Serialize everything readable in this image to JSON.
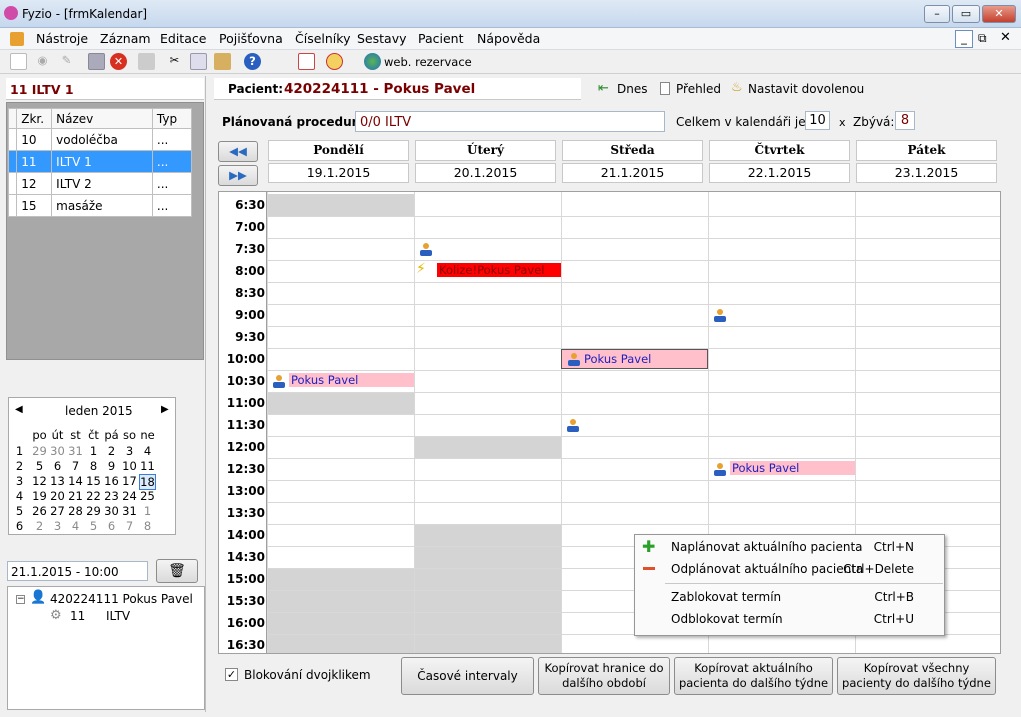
{
  "window": {
    "title": "Fyzio - [frmKalendar]"
  },
  "menu": [
    "Nástroje",
    "Záznam",
    "Editace",
    "Pojišťovna",
    "Číselníky",
    "Sestavy",
    "Pacient",
    "Nápověda"
  ],
  "toolbar": {
    "web_label": "web. rezervace"
  },
  "left": {
    "header": "11 ILTV 1",
    "table": {
      "cols": [
        "Zkr.",
        "Název",
        "Typ"
      ],
      "rows": [
        [
          "10",
          "vodoléčba",
          "..."
        ],
        [
          "11",
          "ILTV 1",
          "..."
        ],
        [
          "12",
          "ILTV 2",
          "..."
        ],
        [
          "15",
          "masáže",
          "..."
        ]
      ],
      "selected_index": 1
    },
    "calendar": {
      "month": "leden 2015",
      "weekdays": [
        "po",
        "út",
        "st",
        "čt",
        "pá",
        "so",
        "ne"
      ],
      "weeks": [
        [
          "1",
          "29",
          "30",
          "31",
          "1",
          "2",
          "3",
          "4"
        ],
        [
          "2",
          "5",
          "6",
          "7",
          "8",
          "9",
          "10",
          "11"
        ],
        [
          "3",
          "12",
          "13",
          "14",
          "15",
          "16",
          "17",
          "18"
        ],
        [
          "4",
          "19",
          "20",
          "21",
          "22",
          "23",
          "24",
          "25"
        ],
        [
          "5",
          "26",
          "27",
          "28",
          "29",
          "30",
          "31",
          "1"
        ],
        [
          "6",
          "2",
          "3",
          "4",
          "5",
          "6",
          "7",
          "8"
        ]
      ],
      "today": "18"
    },
    "datetime": "21.1.2015 - 10:00",
    "tree": {
      "patient": "420224111 Pokus Pavel",
      "child_code": "11",
      "child_name": "ILTV"
    }
  },
  "patient": {
    "label": "Pacient:",
    "value": "420224111 - Pokus Pavel"
  },
  "actions": {
    "today": "Dnes",
    "overview": "Přehled",
    "vacation": "Nastavit dovolenou"
  },
  "procedure": {
    "label": "Plánovaná procedura:",
    "value": "0/0 ILTV",
    "total_label": "Celkem v kalendáři je:",
    "total": "10",
    "x": "x",
    "remain_label": "Zbývá:",
    "remain": "8"
  },
  "days": [
    {
      "name": "Pondělí",
      "date": "19.1.2015"
    },
    {
      "name": "Úterý",
      "date": "20.1.2015"
    },
    {
      "name": "Středa",
      "date": "21.1.2015"
    },
    {
      "name": "Čtvrtek",
      "date": "22.1.2015"
    },
    {
      "name": "Pátek",
      "date": "23.1.2015"
    }
  ],
  "times": [
    "6:30",
    "7:00",
    "7:30",
    "8:00",
    "8:30",
    "9:00",
    "9:30",
    "10:00",
    "10:30",
    "11:00",
    "11:30",
    "12:00",
    "12:30",
    "13:00",
    "13:30",
    "14:00",
    "14:30",
    "15:00",
    "15:30",
    "16:00",
    "16:30"
  ],
  "events": {
    "tue_8": "Kolize!Pokus Pavel",
    "mon_1030": "Pokus Pavel",
    "wed_10": "Pokus Pavel",
    "thu_1230": "Pokus Pavel"
  },
  "context_menu": [
    {
      "label": "Naplánovat aktuálního pacienta",
      "shortcut": "Ctrl+N"
    },
    {
      "label": "Odplánovat aktuálního pacienta",
      "shortcut": "Ctrl+Delete"
    },
    {
      "label": "Zablokovat termín",
      "shortcut": "Ctrl+B"
    },
    {
      "label": "Odblokovat termín",
      "shortcut": "Ctrl+U"
    }
  ],
  "bottom": {
    "checkbox": "Blokování dvojklikem",
    "btn1": "Časové intervaly",
    "btn2": "Kopírovat hranice do dalšího období",
    "btn3": "Kopírovat aktuálního pacienta do dalšího týdne",
    "btn4": "Kopírovat všechny pacienty do dalšího týdne"
  },
  "colors": {
    "selection": "#3399ff",
    "event": "#ffc0cb",
    "collision": "#ff0000",
    "blocked": "#d4d4d4",
    "header_text": "#7a0000"
  }
}
